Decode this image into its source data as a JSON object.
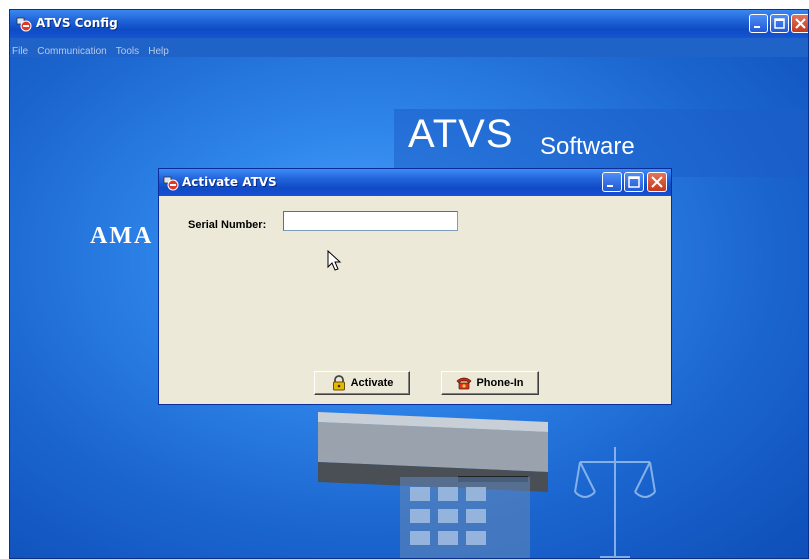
{
  "main_window": {
    "title": "ATVS Config",
    "menu": [
      "File",
      "Communication",
      "Tools",
      "Help"
    ],
    "banner_main": "ATVS",
    "banner_sub": "Software",
    "brand_partial": "AMA"
  },
  "dialog": {
    "title": "Activate ATVS",
    "serial_label": "Serial Number:",
    "serial_value": "",
    "activate_label": "Activate",
    "phone_in_label": "Phone-In"
  },
  "colors": {
    "titlebar": "#0e4bc4",
    "dialog_bg": "#ece9d8",
    "close_button": "#c4381b",
    "workspace": "#2f86ea"
  },
  "icons": {
    "app": "atvs-app-icon",
    "activate": "lock-icon",
    "phone_in": "telephone-icon"
  }
}
